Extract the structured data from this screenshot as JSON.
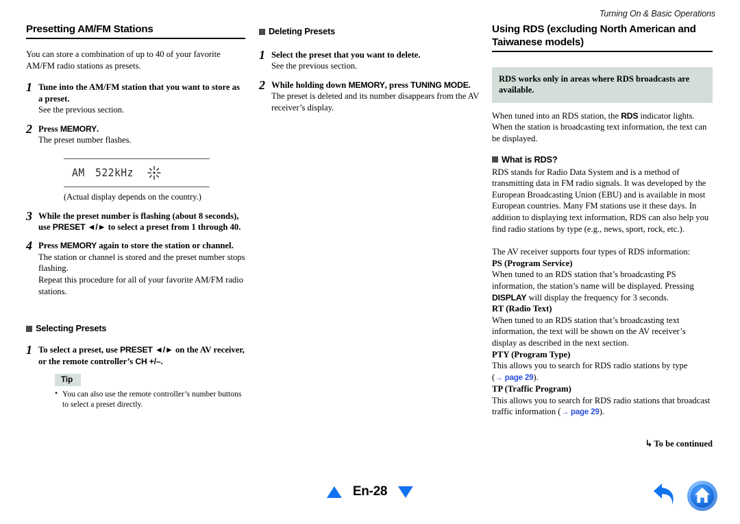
{
  "running_head": "Turning On & Basic Operations",
  "col1": {
    "heading": "Presetting AM/FM Stations",
    "intro": "You can store a combination of up to 40 of your favorite AM/FM radio stations as presets.",
    "steps": [
      {
        "num": "1",
        "title": "Tune into the AM/FM station that you want to store as a preset.",
        "sub": "See the previous section."
      },
      {
        "num": "2",
        "title_pre": "Press ",
        "title_bold": "MEMORY",
        "title_post": ".",
        "sub": "The preset number flashes."
      },
      {
        "num": "3",
        "title_a": "While the preset number is flashing (about 8 seconds), use ",
        "title_key": "PRESET ◄/►",
        "title_b": " to select a preset from 1 through 40."
      },
      {
        "num": "4",
        "title_a": "Press ",
        "title_key": "MEMORY",
        "title_b": " again to store the station or channel.",
        "sub1": "The station or channel is stored and the preset number stops flashing.",
        "sub2": "Repeat this procedure for all of your favorite AM/FM radio stations."
      }
    ],
    "lcd": {
      "band": "AM",
      "frequency": "522kHz",
      "indicator_icon": "sun-flash-icon"
    },
    "figure_caption": "(Actual display depends on the country.)",
    "subsection": {
      "heading": "Selecting Presets",
      "step_num": "1",
      "step_a": "To select a preset, use ",
      "step_key1": "PRESET ◄/►",
      "step_b": " on the AV receiver, or the remote controller’s ",
      "step_key2": "CH +/–",
      "step_c": ".",
      "tip_label": "Tip",
      "tip_items": [
        "You can also use the remote controller’s number buttons to select a preset directly."
      ]
    }
  },
  "col2": {
    "heading": "Deleting Presets",
    "steps": [
      {
        "num": "1",
        "title": "Select the preset that you want to delete.",
        "sub": "See the previous section."
      },
      {
        "num": "2",
        "title_a": "While holding down ",
        "title_key1": "MEMORY",
        "title_b": ", press ",
        "title_key2": "TUNING MODE",
        "title_c": ".",
        "sub": "The preset is deleted and its number disappears from the AV receiver’s display."
      }
    ]
  },
  "col3": {
    "heading": "Using RDS (excluding North American and Taiwanese models)",
    "callout": "RDS works only in areas where RDS broadcasts are available.",
    "intro_a": "When tuned into an RDS station, the ",
    "intro_key": "RDS",
    "intro_b": " indicator lights. When the station is broadcasting text information, the text can be displayed.",
    "what_is_rds_heading": "What is RDS?",
    "what_is_rds_body": "RDS stands for Radio Data System and is a method of transmitting data in FM radio signals. It was developed by the European Broadcasting Union (EBU) and is available in most European countries. Many FM stations use it these days. In addition to displaying text information, RDS can also help you find radio stations by type (e.g., news, sport, rock, etc.).",
    "supports_line": "The AV receiver supports four types of RDS information:",
    "types": [
      {
        "title": "PS (Program Service)",
        "body_a": "When tuned to an RDS station that’s broadcasting PS information, the station’s name will be displayed. Pressing ",
        "key": "DISPLAY",
        "body_b": " will display the frequency for 3 seconds."
      },
      {
        "title": "RT (Radio Text)",
        "body_a": "When tuned to an RDS station that’s broadcasting text information, the text will be shown on the AV receiver’s display as described in the next section."
      },
      {
        "title": "PTY (Program Type)",
        "body_a": "This allows you to search for RDS radio stations by type (",
        "link": "→ page 29",
        "body_b": ")."
      },
      {
        "title": "TP (Traffic Program)",
        "body_a": "This allows you to search for RDS radio stations that broadcast traffic information (",
        "link": "→ page 29",
        "body_b": ")."
      }
    ],
    "to_be_continued": "To be continued",
    "to_be_continued_arrow": "↳"
  },
  "footer": {
    "page_label": "En-28",
    "prev_icon": "triangle-up-icon",
    "next_icon": "triangle-down-icon",
    "back_icon": "back-arrow-icon",
    "home_icon": "home-icon"
  },
  "colors": {
    "link": "#2a4fdb",
    "nav_triangle": "#1273f0",
    "callout_bg": "#d2ded7",
    "tip_bg": "#d7e0da",
    "bullet": "#4a4a4a",
    "home_button": "#1273f0"
  }
}
